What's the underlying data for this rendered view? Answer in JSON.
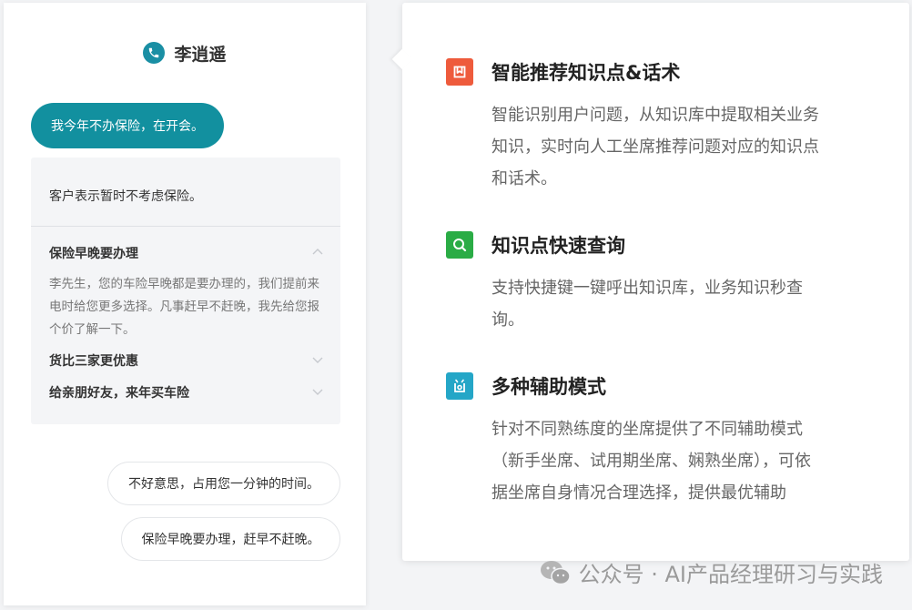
{
  "chat": {
    "contact_name": "李逍遥",
    "customer_message": "我今年不办保险，在开会。",
    "assist": {
      "summary": "客户表示暂时不考虑保险。",
      "suggestions": [
        {
          "title": "保险早晚要办理",
          "expanded": true,
          "body": "李先生，您的车险早晚都是要办理的，我们提前来电时给您更多选择。凡事赶早不赶晚，我先给您报个价了解一下。"
        },
        {
          "title": "货比三家更优惠",
          "expanded": false
        },
        {
          "title": "给亲朋好友，来年买车险",
          "expanded": false
        }
      ]
    },
    "agent_messages": [
      "不好意思，占用您一分钟的时间。",
      "保险早晚要办理，赶早不赶晚。"
    ]
  },
  "features": [
    {
      "icon": "bookmark-icon",
      "color": "#ee5b3c",
      "title": "智能推荐知识点&话术",
      "lines": [
        "智能识别用户问题，从知识库中提取相关业务",
        "知识，实时向人工坐席推荐问题对应的知识点",
        "和话术。"
      ]
    },
    {
      "icon": "search-icon",
      "color": "#2aac45",
      "title": "知识点快速查询",
      "lines": [
        "支持快捷键一键呼出知识库，业务知识秒查",
        "询。"
      ]
    },
    {
      "icon": "assist-icon",
      "color": "#24a6c7",
      "title": "多种辅助模式",
      "lines": [
        "针对不同熟练度的坐席提供了不同辅助模式",
        "（新手坐席、试用期坐席、娴熟坐席），可依",
        "据坐席自身情况合理选择，提供最优辅助"
      ]
    }
  ],
  "watermark": {
    "text": "公众号 · AI产品经理研习与实践"
  },
  "colors": {
    "accent": "#12909f",
    "panel_bg": "#f4f5f7"
  }
}
